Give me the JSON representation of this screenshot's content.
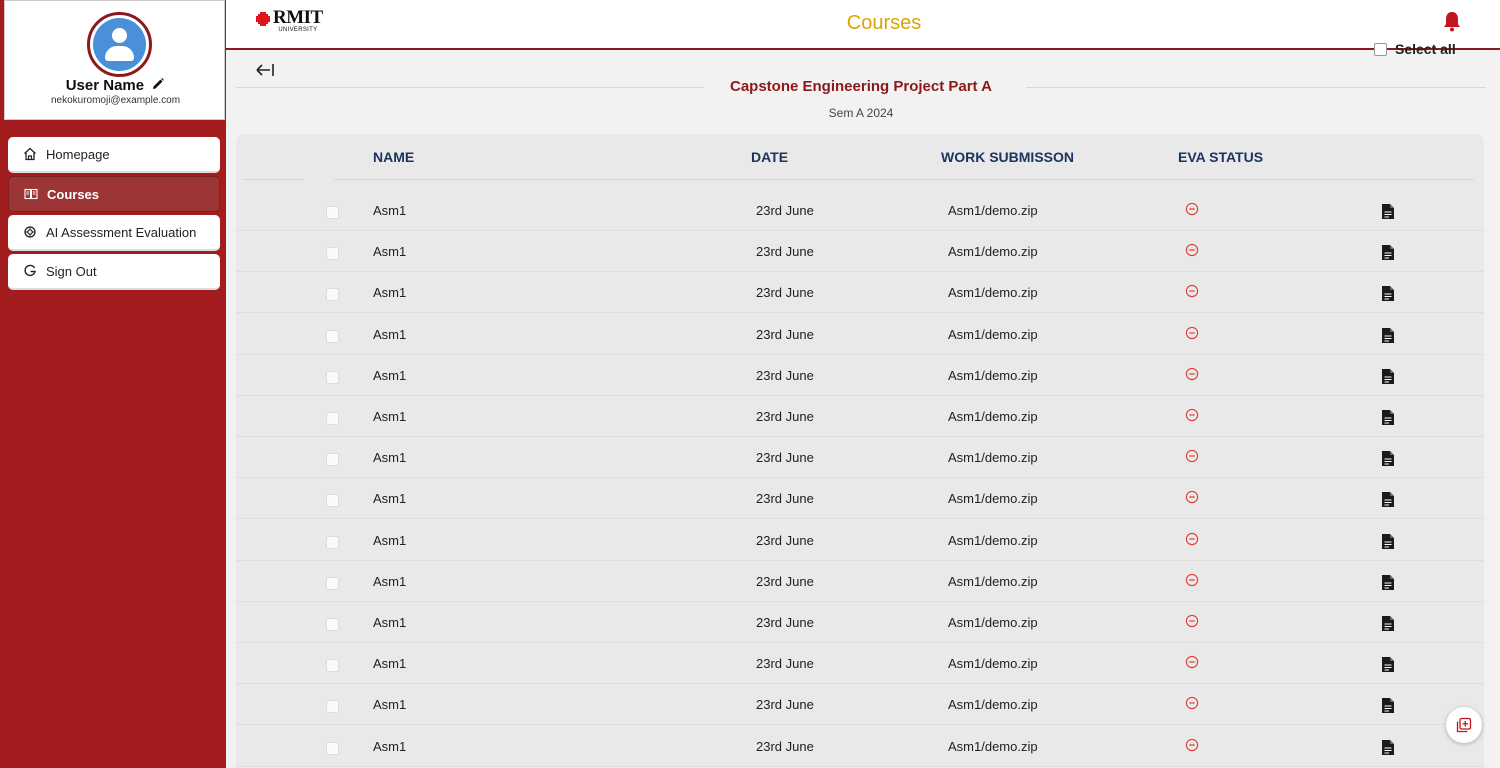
{
  "profile": {
    "name": "User Name",
    "email": "nekokuromoji@example.com"
  },
  "nav": {
    "items": [
      {
        "label": "Homepage",
        "icon": "home-icon",
        "active": false
      },
      {
        "label": "Courses",
        "icon": "book-icon",
        "active": true
      },
      {
        "label": "AI Assessment Evaluation",
        "icon": "ai-icon",
        "active": false
      },
      {
        "label": "Sign Out",
        "icon": "google-icon",
        "active": false
      }
    ]
  },
  "header": {
    "logo_text": "RMIT",
    "logo_sub": "UNIVERSITY",
    "title": "Courses",
    "title_color": "#d9a600",
    "select_all_label": "Select all"
  },
  "course": {
    "title": "Capstone Engineering Project Part A",
    "semester": "Sem A 2024"
  },
  "table": {
    "columns": [
      "NAME",
      "DATE",
      "WORK SUBMISSON",
      "EVA STATUS"
    ],
    "rows": [
      {
        "name": "Asm1",
        "date": "23rd June",
        "work": "Asm1/demo.zip",
        "status": "pending"
      },
      {
        "name": "Asm1",
        "date": "23rd June",
        "work": "Asm1/demo.zip",
        "status": "pending"
      },
      {
        "name": "Asm1",
        "date": "23rd June",
        "work": "Asm1/demo.zip",
        "status": "pending"
      },
      {
        "name": "Asm1",
        "date": "23rd June",
        "work": "Asm1/demo.zip",
        "status": "pending"
      },
      {
        "name": "Asm1",
        "date": "23rd June",
        "work": "Asm1/demo.zip",
        "status": "pending"
      },
      {
        "name": "Asm1",
        "date": "23rd June",
        "work": "Asm1/demo.zip",
        "status": "pending"
      },
      {
        "name": "Asm1",
        "date": "23rd June",
        "work": "Asm1/demo.zip",
        "status": "pending"
      },
      {
        "name": "Asm1",
        "date": "23rd June",
        "work": "Asm1/demo.zip",
        "status": "pending"
      },
      {
        "name": "Asm1",
        "date": "23rd June",
        "work": "Asm1/demo.zip",
        "status": "pending"
      },
      {
        "name": "Asm1",
        "date": "23rd June",
        "work": "Asm1/demo.zip",
        "status": "pending"
      },
      {
        "name": "Asm1",
        "date": "23rd June",
        "work": "Asm1/demo.zip",
        "status": "pending"
      },
      {
        "name": "Asm1",
        "date": "23rd June",
        "work": "Asm1/demo.zip",
        "status": "pending"
      },
      {
        "name": "Asm1",
        "date": "23rd June",
        "work": "Asm1/demo.zip",
        "status": "pending"
      },
      {
        "name": "Asm1",
        "date": "23rd June",
        "work": "Asm1/demo.zip",
        "status": "pending"
      }
    ]
  },
  "colors": {
    "brand_red": "#a31c1e",
    "heading_blue": "#1b3560",
    "status_red": "#e53935"
  }
}
